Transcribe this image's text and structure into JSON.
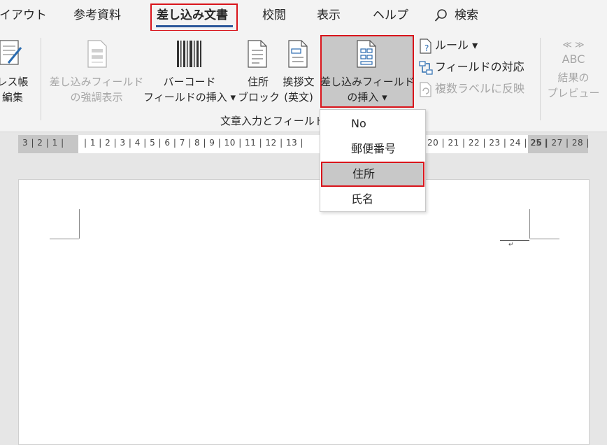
{
  "tabs": [
    {
      "label": "レイアウト",
      "active": false
    },
    {
      "label": "参考資料",
      "active": false
    },
    {
      "label": "差し込み文書",
      "active": true
    },
    {
      "label": "校閲",
      "active": false
    },
    {
      "label": "表示",
      "active": false
    },
    {
      "label": "ヘルプ",
      "active": false
    },
    {
      "label": "検索",
      "active": false
    }
  ],
  "ribbon": {
    "address_book": {
      "line1": "レス帳",
      "line2": "編集"
    },
    "highlight_fields": {
      "line1": "差し込みフィールド",
      "line2": "の強調表示",
      "disabled": true
    },
    "barcode": {
      "line1": "バーコード",
      "line2": "フィールドの挿入 ▾"
    },
    "address_block": {
      "line1": "住所",
      "line2": "ブロック"
    },
    "greeting": {
      "line1": "挨拶文",
      "line2": "(英文)"
    },
    "insert_field": {
      "line1": "差し込みフィールド",
      "line2": "の挿入 ▾"
    },
    "rules": "ルール ▾",
    "match_fields": "フィールドの対応",
    "update_labels": {
      "label": "複数ラベルに反映",
      "disabled": true
    },
    "abc_icon": {
      "arrows": "≪ ≫",
      "text": "ABC"
    },
    "preview": {
      "line1": "結果の",
      "line2": "プレビュー",
      "disabled": true
    },
    "group_label": "文章入力とフィールド"
  },
  "ruler": {
    "left_numbers": "3 | 2 | 1 |",
    "right_numbers": "| 1 | 2 | 3 | 4 | 5 | 6 | 7 | 8 | 9 | 10 | 11 | 12 | 13 |",
    "right_numbers_b": "20 | 21 | 22 | 23 | 24 | 25 |",
    "right_margin_numbers": "26 | 27 | 28 |"
  },
  "dropdown": {
    "items": [
      {
        "label": "No",
        "selected": false
      },
      {
        "label": "郵便番号",
        "selected": false
      },
      {
        "label": "住所",
        "selected": true
      },
      {
        "label": "氏名",
        "selected": false
      }
    ]
  },
  "document": {
    "paragraph_mark": "↵"
  },
  "colors": {
    "accent": "#2b579a",
    "highlight_border": "#d9141b",
    "selected_bg": "#c8c8c8"
  }
}
